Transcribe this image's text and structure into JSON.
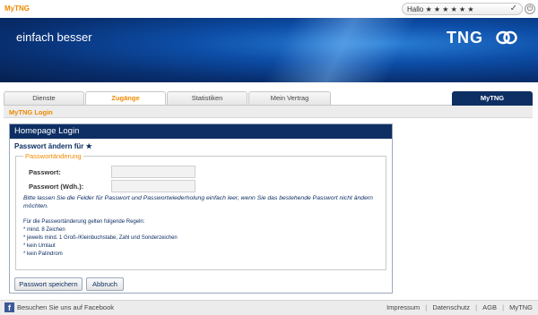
{
  "header": {
    "brand": "MyTNG",
    "greeting": "Hallo ★ ★ ★ ★ ★ ★",
    "check_icon": "checkmark-icon",
    "power_icon": "power-icon"
  },
  "banner": {
    "slogan": "einfach besser",
    "logo_text": "TNG"
  },
  "tabs": [
    {
      "label": "Dienste",
      "active": false
    },
    {
      "label": "Zugänge",
      "active": true
    },
    {
      "label": "Statistiken",
      "active": false
    },
    {
      "label": "Mein Vertrag",
      "active": false
    }
  ],
  "right_tab": {
    "label": "MyTNG"
  },
  "breadcrumb": "MyTNG Login",
  "panel": {
    "title": "Homepage Login",
    "subtitle": "Passwort ändern für ★",
    "legend": "Passwortänderung",
    "password_label": "Passwort:",
    "password_repeat_label": "Passwort (Wdh.):",
    "password_value": "",
    "password_repeat_value": "",
    "note": "Bitte lassen Sie die Felder für Passwort und Passwortwiederholung einfach leer, wenn Sie das bestehende Passwort nicht ändern möchten.",
    "rules_intro": "Für die Passwortänderung gelten folgende Regeln:",
    "rules": [
      "* mind. 8 Zeichen",
      "* jeweils mind. 1 Groß-/Kleinbuchstabe, Zahl und Sonderzeichen",
      "* kein Umlaut",
      "* kein Palindrom"
    ],
    "save_button": "Passwort speichern",
    "cancel_button": "Abbruch"
  },
  "footer": {
    "facebook": "Besuchen Sie uns auf Facebook",
    "links": [
      "Impressum",
      "Datenschutz",
      "AGB",
      "MyTNG"
    ]
  },
  "colors": {
    "accent": "#f08a00",
    "navy": "#0d2f63"
  }
}
